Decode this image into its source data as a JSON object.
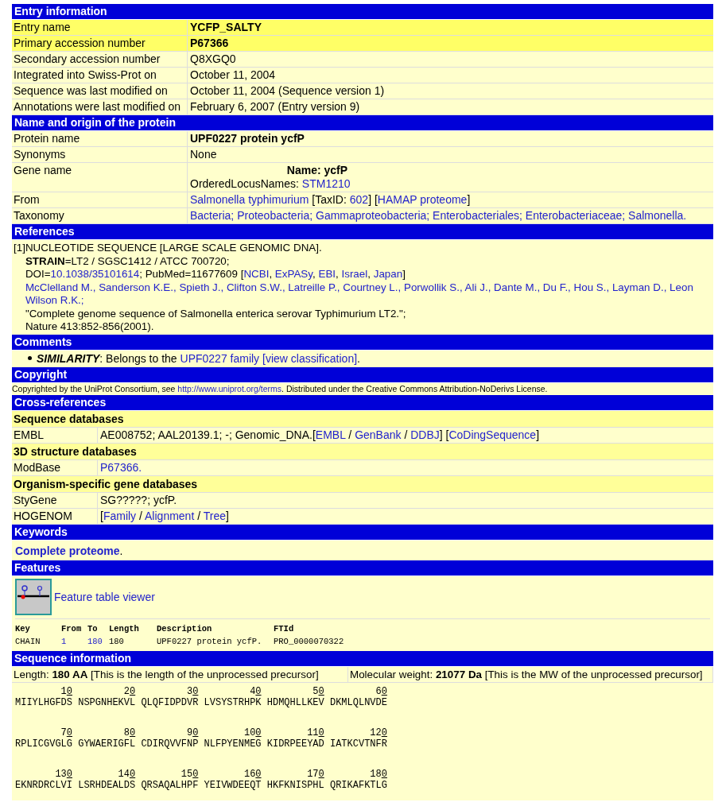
{
  "entry": {
    "title": "Entry information",
    "rows": [
      {
        "label": "Entry name",
        "highlighted": true,
        "strong": true,
        "lines": [
          [
            {
              "text": "YCFP_SALTY",
              "link": false
            }
          ]
        ]
      },
      {
        "label": "Primary accession number",
        "highlighted": true,
        "strong": true,
        "lines": [
          [
            {
              "text": "P67366",
              "link": false
            }
          ]
        ]
      },
      {
        "label": "Secondary accession number",
        "highlighted": false,
        "strong": false,
        "lines": [
          [
            {
              "text": "Q8XGQ0",
              "link": false
            }
          ]
        ]
      },
      {
        "label": "Integrated into Swiss-Prot on",
        "highlighted": false,
        "strong": false,
        "lines": [
          [
            {
              "text": "October 11, 2004",
              "link": false
            }
          ]
        ]
      },
      {
        "label": "Sequence was last modified on",
        "highlighted": false,
        "strong": false,
        "lines": [
          [
            {
              "text": "October 11, 2004 (Sequence version 1)",
              "link": false
            }
          ]
        ]
      },
      {
        "label": "Annotations were last modified on",
        "highlighted": false,
        "strong": false,
        "lines": [
          [
            {
              "text": "February 6, 2007 (Entry version 9)",
              "link": false
            }
          ]
        ]
      }
    ]
  },
  "origin": {
    "title": "Name and origin of the protein",
    "rows": [
      {
        "label": "Protein name",
        "highlighted": false,
        "strong": true,
        "lines": [
          [
            {
              "text": "UPF0227 protein ycfP",
              "link": false
            }
          ]
        ]
      },
      {
        "label": "Synonyms",
        "highlighted": false,
        "strong": false,
        "lines": [
          [
            {
              "text": "None",
              "link": false
            }
          ]
        ]
      },
      {
        "label": "Gene name",
        "highlighted": false,
        "strong": false,
        "lines": [
          [
            {
              "text": "**Name: ycfP**",
              "link": false,
              "centered": true
            }
          ],
          [
            {
              "text": "OrderedLocusNames: ",
              "link": false
            },
            {
              "text": "STM1210",
              "link": true
            }
          ]
        ]
      },
      {
        "label": "From",
        "highlighted": false,
        "strong": false,
        "lines": [
          [
            {
              "text": "Salmonella typhimurium",
              "link": true
            },
            {
              "text": " [TaxID: ",
              "link": false
            },
            {
              "text": "602",
              "link": true
            },
            {
              "text": "] [",
              "link": false
            },
            {
              "text": "HAMAP proteome",
              "link": true
            },
            {
              "text": "]",
              "link": false
            }
          ]
        ]
      },
      {
        "label": "Taxonomy",
        "highlighted": false,
        "strong": false,
        "lines": [
          [
            {
              "text": "Bacteria;",
              "link": true,
              "spaced": true
            },
            {
              "text": "Proteobacteria;",
              "link": true,
              "spaced": true
            },
            {
              "text": "Gammaproteobacteria;",
              "link": true,
              "spaced": true
            },
            {
              "text": "Enterobacteriales;",
              "link": true,
              "spaced": true
            },
            {
              "text": "Enterobacteriaceae;",
              "link": true,
              "spaced": true
            },
            {
              "text": "Salmonella.",
              "link": true
            }
          ]
        ]
      }
    ]
  },
  "references": {
    "title": "References",
    "items": [
      {
        "number": "[1]",
        "lines": [
          [
            {
              "text": "NUCLEOTIDE SEQUENCE [LARGE SCALE GENOMIC DNA].",
              "link": false
            }
          ],
          [
            {
              "text": "**STRAIN**=LT2 / SGSC1412 / ATCC 700720;",
              "link": false
            }
          ],
          [
            {
              "text": "DOI=",
              "link": false
            },
            {
              "text": "10.1038/35101614",
              "link": true
            },
            {
              "text": "; PubMed=11677609 [",
              "link": false
            },
            {
              "text": "NCBI",
              "link": true
            },
            {
              "text": ", ",
              "link": false
            },
            {
              "text": "ExPASy",
              "link": true
            },
            {
              "text": ", ",
              "link": false
            },
            {
              "text": "EBI",
              "link": true
            },
            {
              "text": ", ",
              "link": false
            },
            {
              "text": "Israel",
              "link": true
            },
            {
              "text": ", ",
              "link": false
            },
            {
              "text": "Japan",
              "link": true
            },
            {
              "text": "]",
              "link": false
            }
          ],
          [
            {
              "text": "McClelland M., Sanderson K.E., Spieth J., Clifton S.W., Latreille P., Courtney L., Porwollik S., Ali J., Dante M., Du F., Hou S., Layman D., Leon",
              "link": true
            }
          ],
          [
            {
              "text": "Wilson R.K.;",
              "link": true
            }
          ],
          [
            {
              "text": "\"Complete genome sequence of Salmonella enterica serovar Typhimurium LT2.\";",
              "link": false
            }
          ],
          [
            {
              "text": "Nature 413:852-856(2001).",
              "link": false
            }
          ]
        ]
      }
    ]
  },
  "comments": {
    "title": "Comments",
    "items": [
      {
        "topic": "SIMILARITY",
        "parts": [
          {
            "text": ": Belongs to the ",
            "link": false
          },
          {
            "text": "UPF0227 family",
            "link": true,
            "spaced": true
          },
          {
            "text": "[view classification]",
            "link": true
          },
          {
            "text": ".",
            "link": false
          }
        ]
      }
    ]
  },
  "copyright": {
    "title": "Copyright",
    "parts": [
      {
        "text": "Copyrighted by the UniProt Consortium, see ",
        "link": false
      },
      {
        "text": "http://www.uniprot.org/terms",
        "link": true
      },
      {
        "text": ". Distributed under the Creative Commons Attribution-NoDerivs License.",
        "link": false
      }
    ]
  },
  "cross_references": {
    "title": "Cross-references",
    "groups": [
      {
        "title": "Sequence databases",
        "rows": [
          {
            "label": "EMBL",
            "parts": [
              {
                "text": "AE008752; AAL20139.1; -; Genomic_DNA.[",
                "link": false
              },
              {
                "text": "EMBL",
                "link": true
              },
              {
                "text": " / ",
                "link": false
              },
              {
                "text": "GenBank",
                "link": true
              },
              {
                "text": " / ",
                "link": false
              },
              {
                "text": "DDBJ",
                "link": true
              },
              {
                "text": "] [",
                "link": false
              },
              {
                "text": "CoDingSequence",
                "link": true
              },
              {
                "text": "]",
                "link": false
              }
            ]
          }
        ]
      },
      {
        "title": "3D structure databases",
        "rows": [
          {
            "label": "ModBase",
            "parts": [
              {
                "text": "P67366.",
                "link": true
              }
            ]
          }
        ]
      },
      {
        "title": "Organism-specific gene databases",
        "rows": [
          {
            "label": "StyGene",
            "parts": [
              {
                "text": "SG?????; ycfP.",
                "link": false
              }
            ]
          },
          {
            "label": "HOGENOM",
            "parts": [
              {
                "text": "[",
                "link": false
              },
              {
                "text": "Family",
                "link": true
              },
              {
                "text": " / ",
                "link": false
              },
              {
                "text": "Alignment",
                "link": true
              },
              {
                "text": " / ",
                "link": false
              },
              {
                "text": "Tree",
                "link": true
              },
              {
                "text": "]",
                "link": false
              }
            ]
          }
        ]
      }
    ]
  },
  "keywords": {
    "title": "Keywords",
    "items": [
      {
        "text": "Complete proteome",
        "after": "."
      }
    ]
  },
  "features": {
    "title": "Features",
    "viewer_link": "Feature table viewer",
    "columns": [
      "Key",
      "From",
      "To",
      "Length",
      "Description",
      "FTId"
    ],
    "rows": [
      {
        "key": "CHAIN",
        "from": "1",
        "to": "180",
        "length": "180",
        "description": "UPF0227 protein ycfP.",
        "ftid": "PRO_0000070322"
      }
    ]
  },
  "sequence": {
    "title": "Sequence information",
    "length_parts": [
      "Length: ",
      "180 AA",
      " [This is the length of the unprocessed precursor]"
    ],
    "weight_parts": [
      "Molecular weight: ",
      "21077 Da",
      " [This is the MW of the unprocessed precursor]"
    ],
    "lines": [
      {
        "numbers": [
          "10",
          "20",
          "30",
          "40",
          "50",
          "60"
        ],
        "blocks": [
          "MIIYLHGFDS",
          "NSPGNHEKVL",
          "QLQFIDPDVR",
          "LVSYSTRHPK",
          "HDMQHLLKEV",
          "DKMLQLNVDE"
        ]
      },
      {
        "numbers": [
          "70",
          "80",
          "90",
          "100",
          "110",
          "120"
        ],
        "blocks": [
          "RPLICGVGLG",
          "GYWAERIGFL",
          "CDIRQVVFNP",
          "NLFPYENMEG",
          "KIDRPEEYAD",
          "IATKCVTNFR"
        ]
      },
      {
        "numbers": [
          "130",
          "140",
          "150",
          "160",
          "170",
          "180"
        ],
        "blocks": [
          "EKNRDRCLVI",
          "LSRHDEALDS",
          "QRSAQALHPF",
          "YEIVWDEEQT",
          "HKFKNISPHL",
          "QRIKAFKTLG"
        ]
      }
    ]
  }
}
